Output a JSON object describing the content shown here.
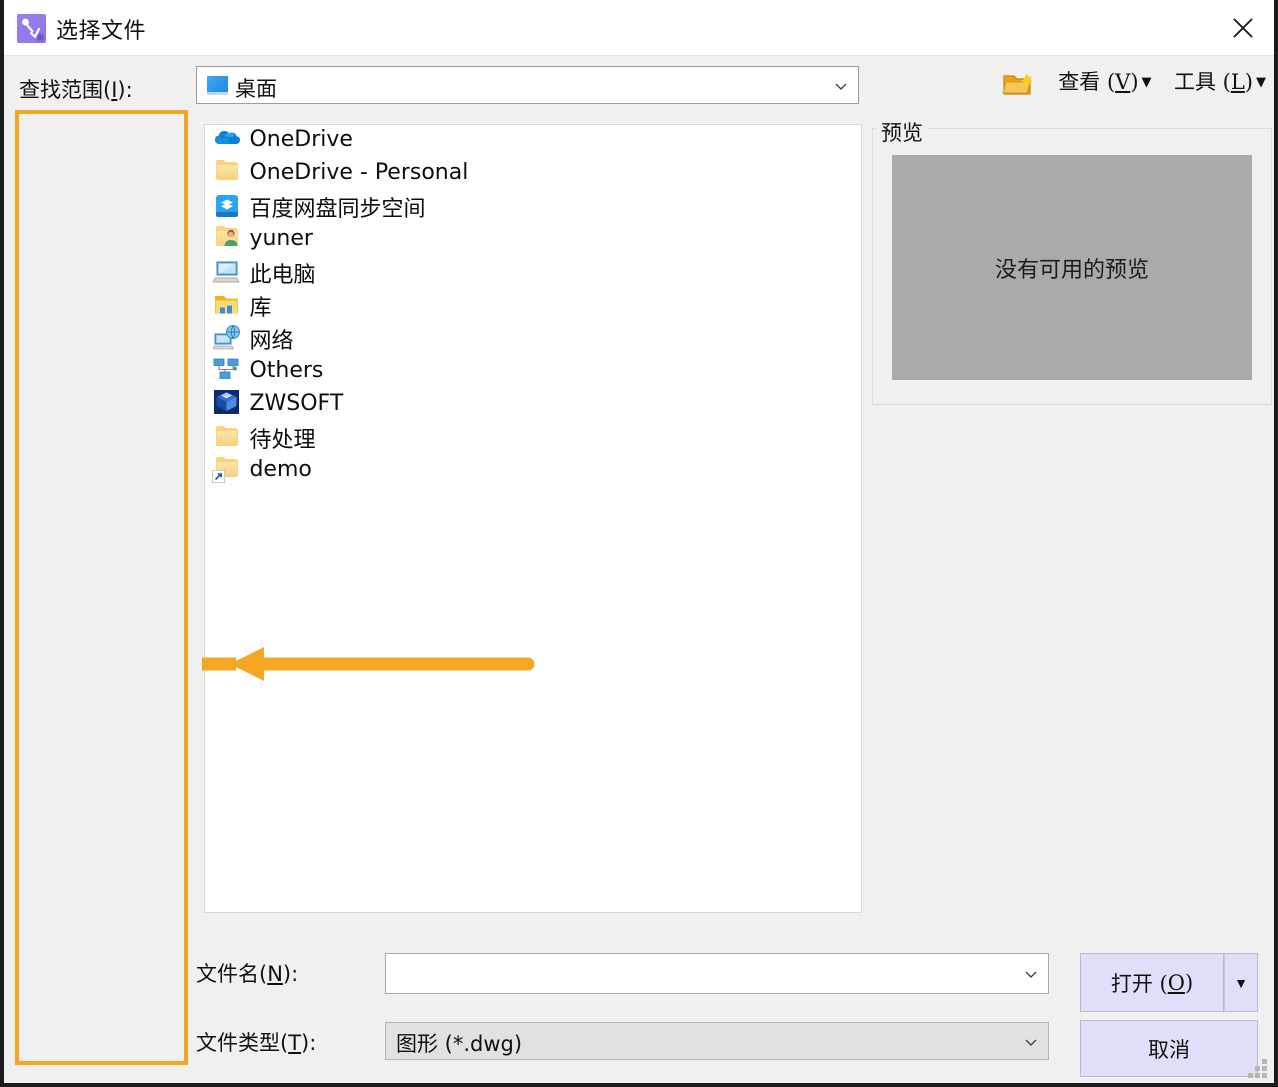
{
  "window": {
    "title": "选择文件",
    "title_icon": "app-curve-icon",
    "close_icon": "close-icon",
    "accent_highlight": "#f5a623",
    "button_fill": "#e0dffa"
  },
  "lookin": {
    "label_prefix": "查找范围(",
    "label_key": "I",
    "label_suffix": "):",
    "value": "桌面",
    "icon": "desktop-icon",
    "caret_icon": "chevron-down-icon"
  },
  "toolbar": {
    "new_folder_icon": "new-folder-icon",
    "items": [
      {
        "prefix": "查看 (",
        "key": "V",
        "suffix": ")",
        "caret": "▼",
        "name": "view-menu"
      },
      {
        "prefix": "工具 (",
        "key": "L",
        "suffix": ")",
        "caret": "▼",
        "name": "tools-menu"
      }
    ]
  },
  "filelist": {
    "items": [
      {
        "label": "OneDrive",
        "icon": "onedrive-cloud-icon"
      },
      {
        "label": "OneDrive - Personal",
        "icon": "folder-icon"
      },
      {
        "label": "百度网盘同步空间",
        "icon": "baidu-netdisk-icon"
      },
      {
        "label": "yuner",
        "icon": "user-folder-icon"
      },
      {
        "label": "此电脑",
        "icon": "this-pc-icon"
      },
      {
        "label": "库",
        "icon": "libraries-icon"
      },
      {
        "label": "网络",
        "icon": "network-icon"
      },
      {
        "label": "Others",
        "icon": "network-nodes-icon"
      },
      {
        "label": "ZWSOFT",
        "icon": "zwsoft-icon"
      },
      {
        "label": "待处理",
        "icon": "folder-icon"
      },
      {
        "label": "demo",
        "icon": "folder-shortcut-icon"
      }
    ]
  },
  "preview": {
    "caption": "预览",
    "empty_text": "没有可用的预览"
  },
  "fields": {
    "filename": {
      "label_prefix": "文件名(",
      "label_key": "N",
      "label_suffix": "):",
      "value": "",
      "placeholder": "",
      "caret_icon": "chevron-down-icon"
    },
    "filetype": {
      "label_prefix": "文件类型(",
      "label_key": "T",
      "label_suffix": "):",
      "value": "图形 (*.dwg)",
      "caret_icon": "chevron-down-icon"
    }
  },
  "buttons": {
    "open": {
      "prefix": "打开 (",
      "key": "O",
      "suffix": ")"
    },
    "open_split_caret": "▼",
    "cancel": "取消"
  },
  "annotations": {
    "arrow": {
      "direction": "left",
      "color": "#f5a623",
      "target": "places-sidebar"
    },
    "highlight_box": {
      "color": "#f5a623",
      "target": "places-sidebar"
    }
  }
}
